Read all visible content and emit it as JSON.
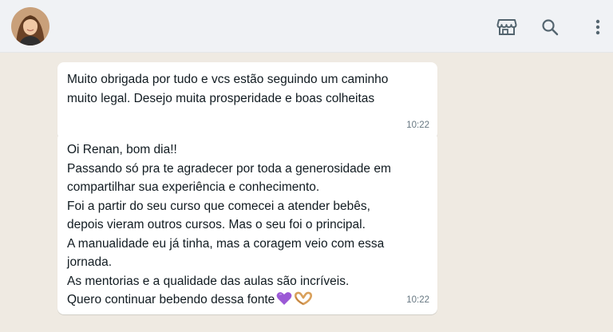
{
  "header": {
    "avatar_icon": "contact-avatar-photo",
    "catalog_icon": "storefront-icon",
    "search_icon": "search-icon",
    "menu_icon": "kebab-menu-icon"
  },
  "messages": [
    {
      "text": "Muito obrigada por tudo e vcs estão seguindo um caminho\nmuito legal. Desejo muita prosperidade e boas colheitas",
      "time": "10:22"
    },
    {
      "text": "Oi Renan, bom dia!!\nPassando só pra te agradecer por toda a generosidade em\ncompartilhar sua experiência e conhecimento.\nFoi a partir do seu curso que comecei a atender bebês,\ndepois vieram outros cursos. Mas o seu foi o principal.\nA manualidade eu já tinha, mas a coragem veio com essa\njornada.\nAs mentorias e a qualidade das aulas são incríveis.\nQuero continuar bebendo dessa fonte",
      "emojis": [
        "purple-heart",
        "heart-hands"
      ],
      "time": "10:22"
    }
  ],
  "colors": {
    "chat_background": "#efeae2",
    "header_background": "#f0f2f5",
    "bubble": "#ffffff",
    "text": "#111b21",
    "timestamp": "#667781",
    "icon": "#54656f"
  }
}
